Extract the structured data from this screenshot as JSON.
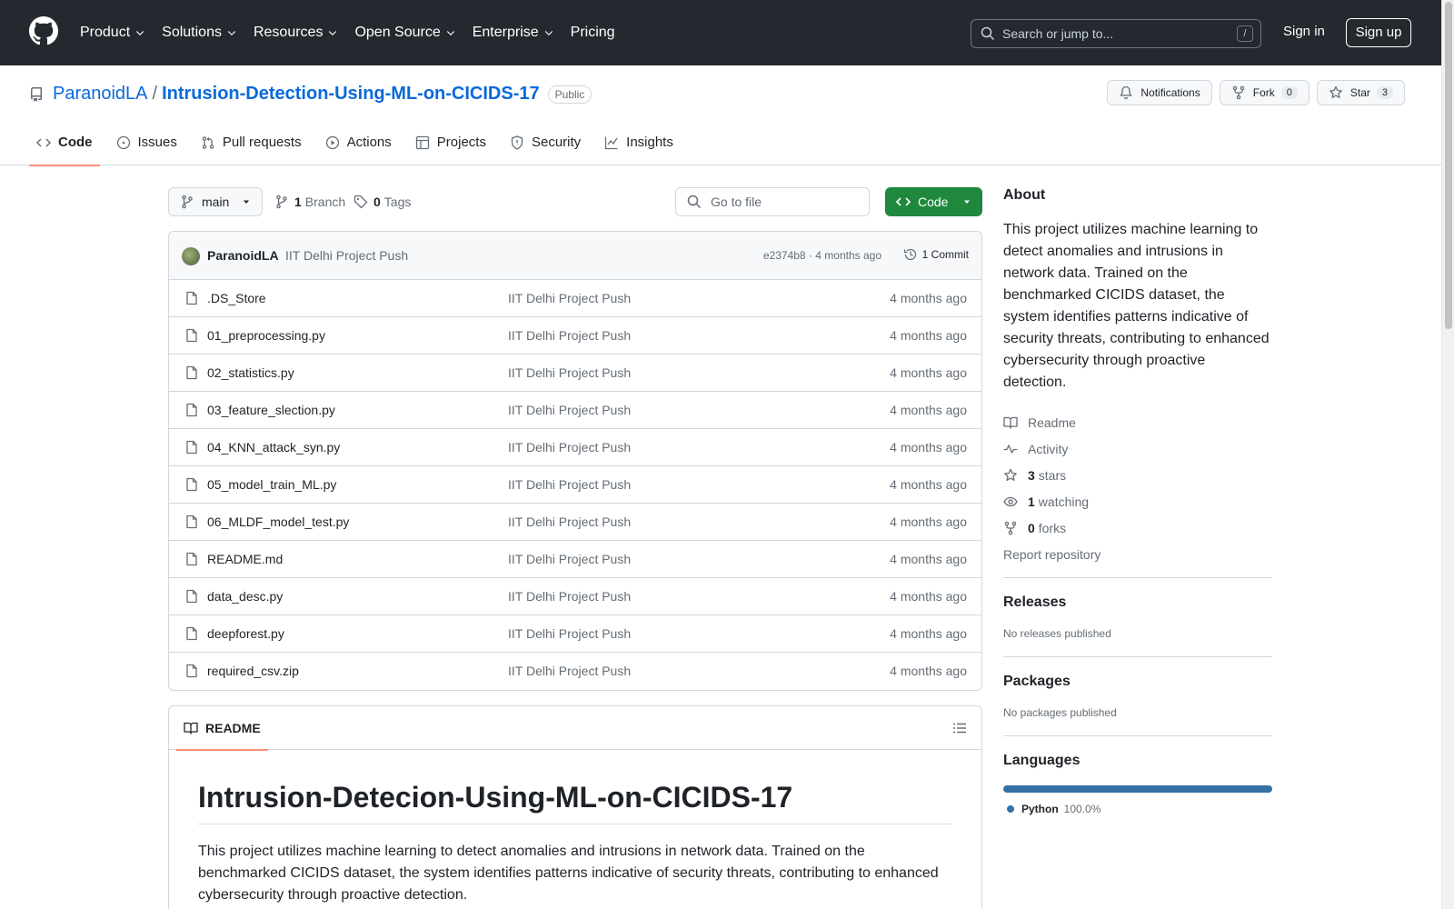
{
  "header": {
    "nav": [
      {
        "label": "Product",
        "dropdown": true
      },
      {
        "label": "Solutions",
        "dropdown": true
      },
      {
        "label": "Resources",
        "dropdown": true
      },
      {
        "label": "Open Source",
        "dropdown": true
      },
      {
        "label": "Enterprise",
        "dropdown": true
      },
      {
        "label": "Pricing",
        "dropdown": false
      }
    ],
    "search_placeholder": "Search or jump to...",
    "search_shortcut": "/",
    "sign_in": "Sign in",
    "sign_up": "Sign up"
  },
  "repo": {
    "owner": "ParanoidLA",
    "separator": "/",
    "name": "Intrusion-Detection-Using-ML-on-CICIDS-17",
    "visibility": "Public",
    "notifications_label": "Notifications",
    "fork_label": "Fork",
    "fork_count": "0",
    "star_label": "Star",
    "star_count": "3"
  },
  "tabs": [
    {
      "label": "Code",
      "icon": "code-icon",
      "active": true
    },
    {
      "label": "Issues",
      "icon": "issue-icon",
      "active": false
    },
    {
      "label": "Pull requests",
      "icon": "pull-request-icon",
      "active": false
    },
    {
      "label": "Actions",
      "icon": "play-icon",
      "active": false
    },
    {
      "label": "Projects",
      "icon": "table-icon",
      "active": false
    },
    {
      "label": "Security",
      "icon": "shield-icon",
      "active": false
    },
    {
      "label": "Insights",
      "icon": "graph-icon",
      "active": false
    }
  ],
  "branchbar": {
    "branch": "main",
    "branch_count": "1",
    "branch_label": "Branch",
    "tag_count": "0",
    "tag_label": "Tags",
    "goto_placeholder": "Go to file",
    "code_button": "Code"
  },
  "commit": {
    "author": "ParanoidLA",
    "message": "IIT Delhi Project Push",
    "meta": "e2374b8 · 4 months ago",
    "count_label": "1 Commit"
  },
  "files": [
    {
      "name": ".DS_Store",
      "message": "IIT Delhi Project Push",
      "age": "4 months ago"
    },
    {
      "name": "01_preprocessing.py",
      "message": "IIT Delhi Project Push",
      "age": "4 months ago"
    },
    {
      "name": "02_statistics.py",
      "message": "IIT Delhi Project Push",
      "age": "4 months ago"
    },
    {
      "name": "03_feature_slection.py",
      "message": "IIT Delhi Project Push",
      "age": "4 months ago"
    },
    {
      "name": "04_KNN_attack_syn.py",
      "message": "IIT Delhi Project Push",
      "age": "4 months ago"
    },
    {
      "name": "05_model_train_ML.py",
      "message": "IIT Delhi Project Push",
      "age": "4 months ago"
    },
    {
      "name": "06_MLDF_model_test.py",
      "message": "IIT Delhi Project Push",
      "age": "4 months ago"
    },
    {
      "name": "README.md",
      "message": "IIT Delhi Project Push",
      "age": "4 months ago"
    },
    {
      "name": "data_desc.py",
      "message": "IIT Delhi Project Push",
      "age": "4 months ago"
    },
    {
      "name": "deepforest.py",
      "message": "IIT Delhi Project Push",
      "age": "4 months ago"
    },
    {
      "name": "required_csv.zip",
      "message": "IIT Delhi Project Push",
      "age": "4 months ago"
    }
  ],
  "readme": {
    "tab_label": "README",
    "title": "Intrusion-Detecion-Using-ML-on-CICIDS-17",
    "body": "This project utilizes machine learning to detect anomalies and intrusions in network data. Trained on the benchmarked CICIDS dataset, the system identifies patterns indicative of security threats, contributing to enhanced cybersecurity through proactive detection."
  },
  "about": {
    "heading": "About",
    "description": "This project utilizes machine learning to detect anomalies and intrusions in network data. Trained on the benchmarked CICIDS dataset, the system identifies patterns indicative of security threats, contributing to enhanced cybersecurity through proactive detection.",
    "readme_link": "Readme",
    "activity_link": "Activity",
    "stars_count": "3",
    "stars_label": "stars",
    "watching_count": "1",
    "watching_label": "watching",
    "forks_count": "0",
    "forks_label": "forks",
    "report_link": "Report repository"
  },
  "releases": {
    "heading": "Releases",
    "text": "No releases published"
  },
  "packages": {
    "heading": "Packages",
    "text": "No packages published"
  },
  "languages": {
    "heading": "Languages",
    "items": [
      {
        "name": "Python",
        "percent": "100.0%",
        "color": "#3572a5"
      }
    ]
  },
  "colors": {
    "header_bg": "#24292f",
    "link": "#0969da",
    "primary_button": "#1f883d",
    "active_tab_underline": "#fd8c73"
  }
}
